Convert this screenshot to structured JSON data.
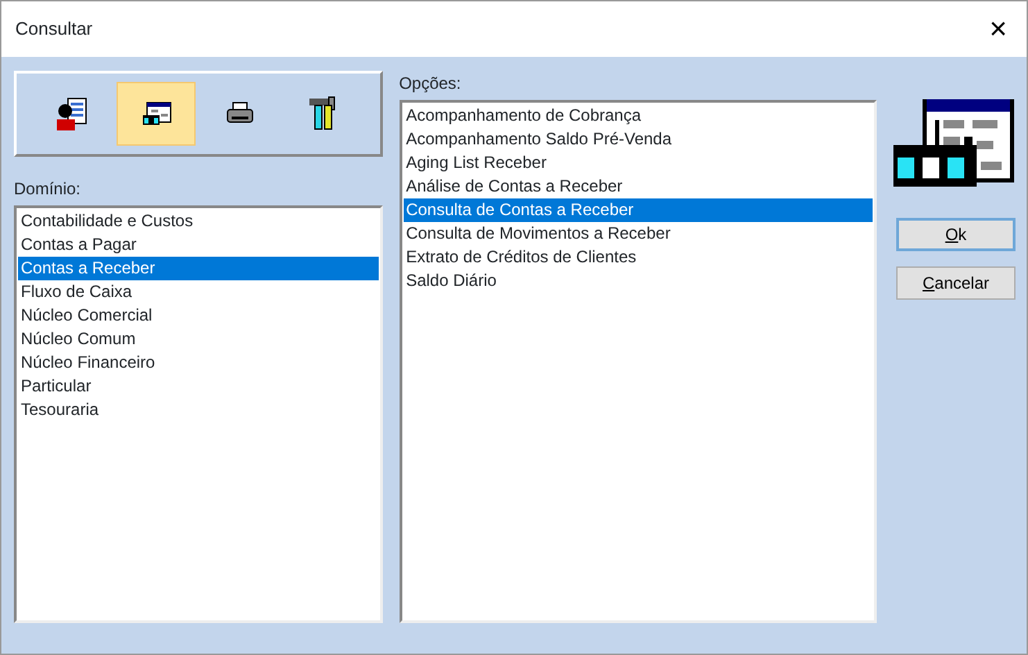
{
  "window": {
    "title": "Consultar",
    "close": "×"
  },
  "toolbar": [
    {
      "kind": "person-doc",
      "selected": false
    },
    {
      "kind": "chart-window",
      "selected": true
    },
    {
      "kind": "printer",
      "selected": false
    },
    {
      "kind": "tools",
      "selected": false
    }
  ],
  "domain": {
    "label": "Domínio:",
    "items": [
      {
        "text": "Contabilidade e Custos",
        "selected": false
      },
      {
        "text": "Contas a Pagar",
        "selected": false
      },
      {
        "text": "Contas a Receber",
        "selected": true
      },
      {
        "text": "Fluxo de Caixa",
        "selected": false
      },
      {
        "text": "Núcleo Comercial",
        "selected": false
      },
      {
        "text": "Núcleo Comum",
        "selected": false
      },
      {
        "text": "Núcleo Financeiro",
        "selected": false
      },
      {
        "text": "Particular",
        "selected": false
      },
      {
        "text": "Tesouraria",
        "selected": false
      }
    ]
  },
  "options": {
    "label": "Opções:",
    "items": [
      {
        "text": "Acompanhamento de Cobrança",
        "selected": false
      },
      {
        "text": "Acompanhamento Saldo Pré-Venda",
        "selected": false
      },
      {
        "text": "Aging List Receber",
        "selected": false
      },
      {
        "text": "Análise de Contas a Receber",
        "selected": false
      },
      {
        "text": "Consulta de Contas a Receber",
        "selected": true
      },
      {
        "text": "Consulta de Movimentos a Receber",
        "selected": false
      },
      {
        "text": "Extrato de Créditos de Clientes",
        "selected": false
      },
      {
        "text": "Saldo Diário",
        "selected": false
      }
    ]
  },
  "buttons": [
    {
      "label": "Ok",
      "default": true
    },
    {
      "label": "Cancelar",
      "default": false
    }
  ]
}
